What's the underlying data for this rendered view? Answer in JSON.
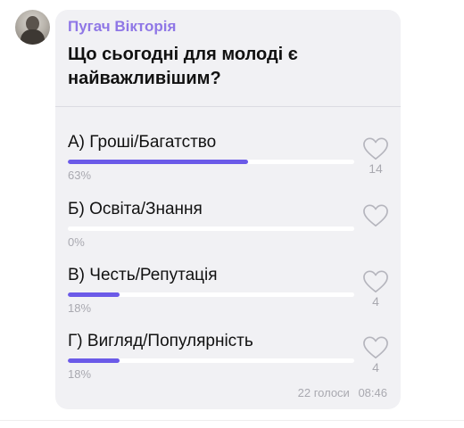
{
  "post": {
    "author": "Пугач Вікторія",
    "question": "Що сьогодні для молоді є найважливішим?"
  },
  "poll": {
    "accent_color": "#6b5ae8",
    "options": [
      {
        "label": "А) Гроші/Багатство",
        "percent_text": "63%",
        "percent": 63,
        "likes": "14"
      },
      {
        "label": "Б) Освіта/Знання",
        "percent_text": "0%",
        "percent": 0,
        "likes": ""
      },
      {
        "label": "В) Честь/Репутація",
        "percent_text": "18%",
        "percent": 18,
        "likes": "4"
      },
      {
        "label": "Г) Вигляд/Популярність",
        "percent_text": "18%",
        "percent": 18,
        "likes": "4"
      }
    ]
  },
  "footer": {
    "votes": "22 голоси",
    "time": "08:46"
  }
}
